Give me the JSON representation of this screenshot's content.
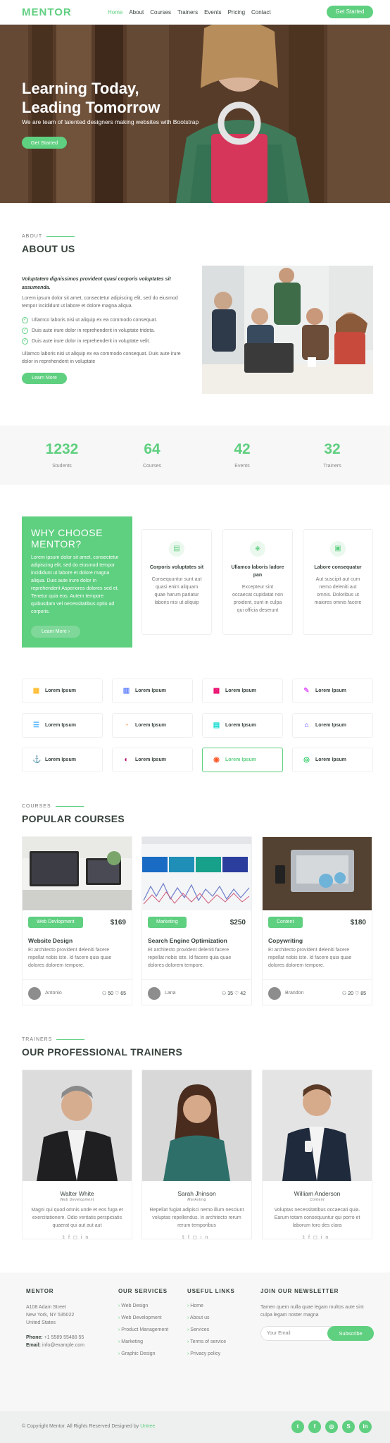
{
  "header": {
    "logo": "MENTOR",
    "nav": [
      "Home",
      "About",
      "Courses",
      "Trainers",
      "Events",
      "Pricing",
      "Contact"
    ],
    "cta": "Get Started"
  },
  "hero": {
    "title_line1": "Learning Today,",
    "title_line2": "Leading Tomorrow",
    "subtitle": "We are team of talented designers making websites with Bootstrap",
    "button": "Get Started"
  },
  "about": {
    "tag": "ABOUT",
    "title": "ABOUT US",
    "lead": "Voluptatem dignissimos provident quasi corporis voluptates sit assumenda.",
    "para1": "Lorem ipsum dolor sit amet, consectetur adipiscing elit, sed do eiusmod tempor incididunt ut labore et dolore magna aliqua.",
    "checks": [
      "Ullamco laboris nisi ut aliquip ex ea commodo consequat.",
      "Duis aute irure dolor in reprehenderit in voluptate trideta.",
      "Duis aute irure dolor in reprehenderit in voluptate velit."
    ],
    "para2": "Ullamco laboris nisi ut aliquip ex ea commodo consequat. Duis aute irure dolor in reprehenderit in voluptate",
    "button": "Learn More"
  },
  "counts": [
    {
      "value": "1232",
      "label": "Students"
    },
    {
      "value": "64",
      "label": "Courses"
    },
    {
      "value": "42",
      "label": "Events"
    },
    {
      "value": "32",
      "label": "Trainers"
    }
  ],
  "why": {
    "title_line1": "WHY CHOOSE",
    "title_line2": "MENTOR?",
    "text": "Lorem ipsum dolor sit amet, consectetur adipiscing elit, sed do eiusmod tempor incididunt ut labore et dolore magna aliqua. Duis aute irure dolor in reprehenderit Asperiores dolores sed et. Tenetur quia eos. Autem tempore quibusdam vel necessitatibus optio ad corporis.",
    "button": "Learn More ›",
    "cards": [
      {
        "title": "Corporis voluptates sit",
        "desc": "Consequuntur sunt aut quasi enim aliquam quae harum pariatur laboris nisi ut aliquip"
      },
      {
        "title": "Ullamco laboris ladore pan",
        "desc": "Excepteur sint occaecat cupidatat non proident, sunt in culpa qui officia deserunt"
      },
      {
        "title": "Labore consequatur",
        "desc": "Aut suscipit aut cum nemo deleniti aut omnis. Doloribus ut maiores omnis facere"
      }
    ]
  },
  "features": [
    {
      "label": "Lorem Ipsum",
      "icon": "store-icon",
      "color": "#ffbb2c"
    },
    {
      "label": "Lorem Ipsum",
      "icon": "chart-icon",
      "color": "#5578ff"
    },
    {
      "label": "Lorem Ipsum",
      "icon": "calendar-icon",
      "color": "#e80368"
    },
    {
      "label": "Lorem Ipsum",
      "icon": "paint-icon",
      "color": "#e361ff"
    },
    {
      "label": "Lorem Ipsum",
      "icon": "database-icon",
      "color": "#47aeff"
    },
    {
      "label": "Lorem Ipsum",
      "icon": "gauge-icon",
      "color": "#ffa76e"
    },
    {
      "label": "Lorem Ipsum",
      "icon": "file-icon",
      "color": "#11dbcf"
    },
    {
      "label": "Lorem Ipsum",
      "icon": "id-badge-icon",
      "color": "#4233ff"
    },
    {
      "label": "Lorem Ipsum",
      "icon": "anchor-icon",
      "color": "#b2904f"
    },
    {
      "label": "Lorem Ipsum",
      "icon": "disc-icon",
      "color": "#b20969"
    },
    {
      "label": "Lorem Ipsum",
      "icon": "broadcast-icon",
      "color": "#ff5828"
    },
    {
      "label": "Lorem Ipsum",
      "icon": "fingerprint-icon",
      "color": "#29cc61"
    }
  ],
  "courses": {
    "tag": "COURSES",
    "title": "POPULAR COURSES",
    "items": [
      {
        "category": "Web Devlopment",
        "price": "$169",
        "title": "Website Design",
        "desc": "Et architecto provident deleniti facere repellat nobis iste. Id facere quia quae dolores dolorem tempore.",
        "trainer": "Antonio",
        "users": "50",
        "likes": "65"
      },
      {
        "category": "Marketing",
        "price": "$250",
        "title": "Search Engine Optimization",
        "desc": "Et architecto provident deleniti facere repellat nobis iste. Id facere quia quae dolores dolorem tempore.",
        "trainer": "Lana",
        "users": "35",
        "likes": "42"
      },
      {
        "category": "Content",
        "price": "$180",
        "title": "Copywriting",
        "desc": "Et architecto provident deleniti facere repellat nobis iste. Id facere quia quae dolores dolorem tempore.",
        "trainer": "Brandon",
        "users": "20",
        "likes": "85"
      }
    ]
  },
  "trainers": {
    "tag": "TRAINERS",
    "title": "OUR PROFESSIONAL TRAINERS",
    "items": [
      {
        "name": "Walter White",
        "role": "Web Development",
        "desc": "Magni qui quod omnis unde et eos fuga et exercitationem. Odio veritatis perspiciatis quaerat qui aut aut aut"
      },
      {
        "name": "Sarah Jhinson",
        "role": "Marketing",
        "desc": "Repellat fugiat adipisci nemo illum nesciunt voluptas repellendus. In architecto rerum rerum temporibus"
      },
      {
        "name": "William Anderson",
        "role": "Content",
        "desc": "Voluptas necessitatibus occaecati quia. Earum totam consequuntur qui porro et laborum toro des clara"
      }
    ]
  },
  "footer": {
    "brand": "MENTOR",
    "address1": "A108 Adam Street",
    "address2": "New York, NY 535022",
    "address3": "United States",
    "phone_label": "Phone:",
    "phone": "+1 5589 55488 55",
    "email_label": "Email:",
    "email": "info@example.com",
    "services_title": "OUR SERVICES",
    "services": [
      "Web Design",
      "Web Development",
      "Product Management",
      "Marketing",
      "Graphic Design"
    ],
    "links_title": "USEFUL LINKS",
    "links": [
      "Home",
      "About us",
      "Services",
      "Terms of service",
      "Privacy policy"
    ],
    "newsletter_title": "JOIN OUR NEWSLETTER",
    "newsletter_text": "Tamen quem nulla quae legam multos aute sint culpa legam noster magna",
    "newsletter_placeholder": "Your Email",
    "newsletter_button": "Subscribe",
    "copyright": "© Copyright Mentor. All Rights Reserved Designed by",
    "designer": "Untree",
    "socials": [
      "twitter-icon",
      "facebook-icon",
      "instagram-icon",
      "skype-icon",
      "linkedin-icon"
    ]
  },
  "colors": {
    "accent": "#5fcf80",
    "text": "#37423b",
    "muted": "#777777"
  }
}
